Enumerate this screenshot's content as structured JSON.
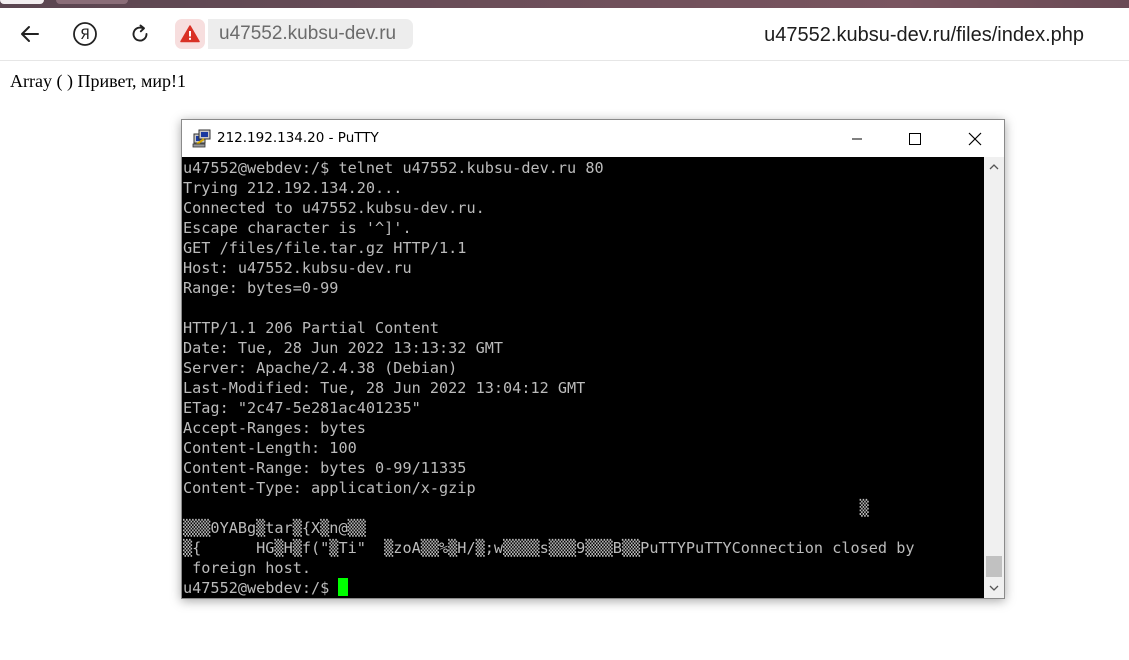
{
  "browser": {
    "url_host": "u47552.kubsu-dev.ru",
    "page_title": "u47552.kubsu-dev.ru/files/index.php",
    "icons": [
      "back-arrow-icon",
      "yandex-icon",
      "reload-icon",
      "warning-icon"
    ],
    "colors": {
      "warning": "#d93025",
      "warning_bg": "#f7dede"
    }
  },
  "page": {
    "text": "Array ( ) Привет, мир!1"
  },
  "putty": {
    "title": "212.192.134.20 - PuTTY",
    "icons": [
      "putty-icon",
      "minimize-icon",
      "maximize-icon",
      "close-icon"
    ],
    "terminal_lines": [
      "u47552@webdev:/$ telnet u47552.kubsu-dev.ru 80",
      "Trying 212.192.134.20...",
      "Connected to u47552.kubsu-dev.ru.",
      "Escape character is '^]'.",
      "GET /files/file.tar.gz HTTP/1.1",
      "Host: u47552.kubsu-dev.ru",
      "Range: bytes=0-99",
      "",
      "HTTP/1.1 206 Partial Content",
      "Date: Tue, 28 Jun 2022 13:13:32 GMT",
      "Server: Apache/2.4.38 (Debian)",
      "Last-Modified: Tue, 28 Jun 2022 13:04:12 GMT",
      "ETag: \"2c47-5e281ac401235\"",
      "Accept-Ranges: bytes",
      "Content-Length: 100",
      "Content-Range: bytes 0-99/11335",
      "Content-Type: application/x-gzip",
      "                                                                          ▒",
      "▒▒▒0YABg▒tar▒{X▒n@▒▒",
      "▒{      HG▒H▒f(\"▒Ti\"  ▒zoA▒▒%▒H/▒;w▒▒▒▒s▒▒▒9▒▒▒B▒▒PuTTYPuTTYConnection closed by",
      " foreign host."
    ],
    "prompt": "u47552@webdev:/$ ",
    "colors": {
      "terminal_bg": "#000000",
      "terminal_fg": "#bbbbbb",
      "cursor": "#00ff00"
    }
  }
}
